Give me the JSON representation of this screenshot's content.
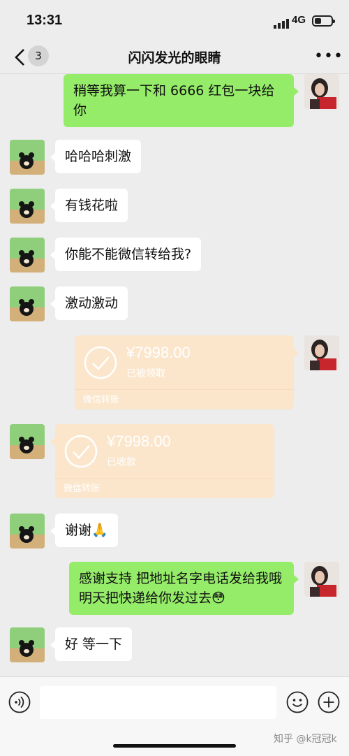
{
  "status_bar": {
    "time": "13:31",
    "network": "4G"
  },
  "nav": {
    "back_count": "3",
    "title": "闪闪发光的眼睛",
    "more": "•••"
  },
  "messages": [
    {
      "side": "right",
      "type": "text",
      "text": "稍等我算一下和 6666 红包一块给你"
    },
    {
      "side": "left",
      "type": "text",
      "text": "哈哈哈刺激"
    },
    {
      "side": "left",
      "type": "text",
      "text": "有钱花啦"
    },
    {
      "side": "left",
      "type": "text",
      "text": "你能不能微信转给我?"
    },
    {
      "side": "left",
      "type": "text",
      "text": "激动激动"
    },
    {
      "side": "right",
      "type": "transfer",
      "amount": "¥7998.00",
      "status": "已被领取",
      "footer": "微信转账"
    },
    {
      "side": "left",
      "type": "transfer",
      "amount": "¥7998.00",
      "status": "已收款",
      "footer": "微信转账"
    },
    {
      "side": "left",
      "type": "text",
      "text": "谢谢🙏"
    },
    {
      "side": "right",
      "type": "text",
      "text": "感谢支持 把地址名字电话发给我哦 明天把快递给你发过去😳"
    },
    {
      "side": "left",
      "type": "text",
      "text": "好 等一下"
    }
  ],
  "input_bar": {
    "voice_icon": "voice-icon",
    "emoji_icon": "emoji-icon",
    "plus_icon": "plus-icon"
  },
  "watermark": "知乎 @k冠冠k",
  "colors": {
    "background": "#ededed",
    "sent_bubble": "#95ec69",
    "received_bubble": "#ffffff",
    "transfer": "#fbe6cc"
  }
}
